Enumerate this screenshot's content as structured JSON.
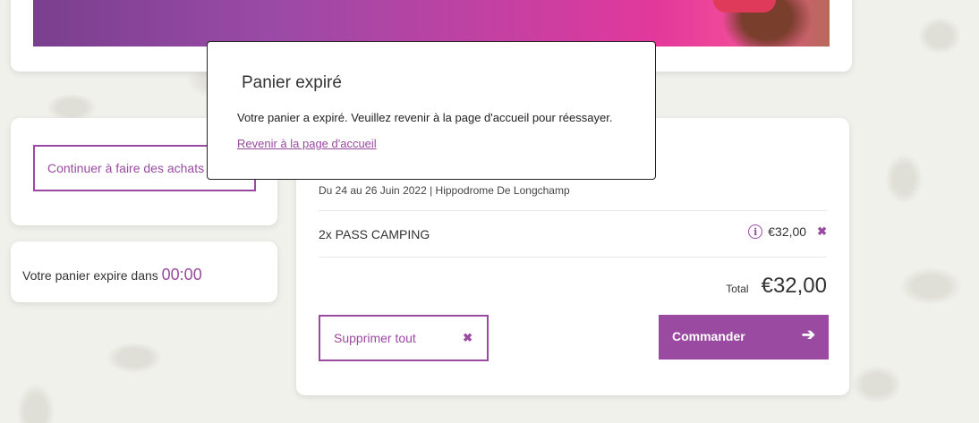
{
  "left": {
    "continue_label": "Continuer à faire des achats",
    "expire_text": "Votre panier expire dans",
    "expire_time": "00:00"
  },
  "cart": {
    "event_date": "Du 24 au 26 Juin 2022 | Hippodrome De Longchamp",
    "item_name": "2x PASS CAMPING",
    "item_price": "€32,00",
    "info_icon": "i",
    "remove_icon": "✖",
    "total_label": "Total",
    "total_value": "€32,00",
    "delete_all_label": "Supprimer tout",
    "order_label": "Commander",
    "order_arrow": "➔"
  },
  "modal": {
    "title": "Panier expiré",
    "body": "Votre panier a expiré. Veuillez revenir à la page d'accueil pour réessayer.",
    "link": "Revenir à la page d'accueil"
  },
  "colors": {
    "accent": "#9a4aa0",
    "background": "#f1f1ec"
  }
}
